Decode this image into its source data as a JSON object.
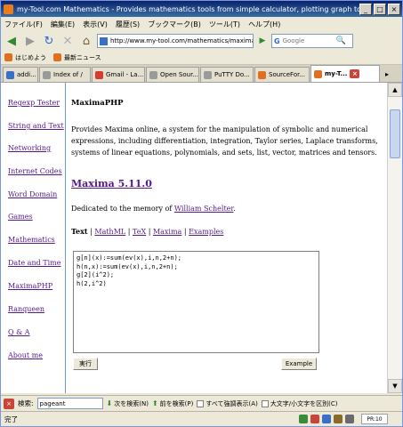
{
  "window": {
    "title": "my-Tool.com Mathematics - Provides mathematics tools from simple calculator, plotting graph to advanced calculus",
    "min": "_",
    "max": "□",
    "close": "×"
  },
  "menu": [
    "ファイル(F)",
    "編集(E)",
    "表示(V)",
    "履歴(S)",
    "ブックマーク(B)",
    "ツール(T)",
    "ヘルプ(H)"
  ],
  "nav": {
    "back": "◀",
    "forward": "▶",
    "reload": "↻",
    "stop": "✕",
    "home": "⌂",
    "url": "http://www.my-tool.com/mathematics/maxima/",
    "go": "▶",
    "search_engine": "G",
    "search_placeholder": "Google",
    "search_icon": "🔍"
  },
  "bookmarks": [
    {
      "label": "はじめよう",
      "color": "#e07020"
    },
    {
      "label": "最新ニュース",
      "color": "#e07020"
    }
  ],
  "tabs": [
    {
      "label": "addi...",
      "color": "#3a6fc4",
      "active": false
    },
    {
      "label": "Index of /",
      "color": "#9a9a9a",
      "active": false
    },
    {
      "label": "Gmail - La...",
      "color": "#d33c2e",
      "active": false
    },
    {
      "label": "Open Sour...",
      "color": "#9a9a9a",
      "active": false
    },
    {
      "label": "PuTTY Do...",
      "color": "#9a9a9a",
      "active": false
    },
    {
      "label": "SourceFor...",
      "color": "#e07020",
      "active": false
    },
    {
      "label": "my-T...",
      "color": "#e07020",
      "active": true
    }
  ],
  "tab_close": "×",
  "tab_scroll": "▸",
  "sidebar": [
    "Regexp Tester",
    "String and Text",
    "Networking",
    "Internet Codes",
    "Word Domain",
    "Games",
    "Mathematics",
    "Date and Time",
    "MaximaPHP",
    "Ranqueen",
    "Q & A",
    "About me"
  ],
  "main": {
    "heading": "MaximaPHP",
    "description": "Provides Maxima online, a system for the manipulation of symbolic and numerical expressions, including differentiation, integration, Taylor series, Laplace transforms, systems of linear equations, polynomials, and sets, list, vector, matrices and tensors.",
    "version_link": "Maxima 5.11.0",
    "dedication_prefix": "Dedicated to the memory of ",
    "dedication_link": "William Schelter",
    "dedication_suffix": ".",
    "formats": {
      "current": "Text",
      "sep": " | ",
      "links": [
        "MathML",
        "TeX",
        "Maxima",
        "Examples"
      ]
    },
    "code": "g[n](x):=sum(ev(x),i,n,2+n);\nh(n,x):=sum(ev(x),i,n,2+n);\ng[2](i^2);\nh(2,i^2)",
    "run_button": "実行",
    "example_button": "Example"
  },
  "scroll": {
    "up": "▲",
    "down": "▼"
  },
  "findbar": {
    "close": "×",
    "label": "検索:",
    "value": "pageant",
    "next_arrow": "⬇",
    "next": "次を検索(N)",
    "prev_arrow": "⬆",
    "prev": "前を検索(P)",
    "highlight": "すべて強調表示(A)",
    "matchcase": "大文字/小文字を区別(C)"
  },
  "status": {
    "text": "完了",
    "pr": "PR:10"
  }
}
